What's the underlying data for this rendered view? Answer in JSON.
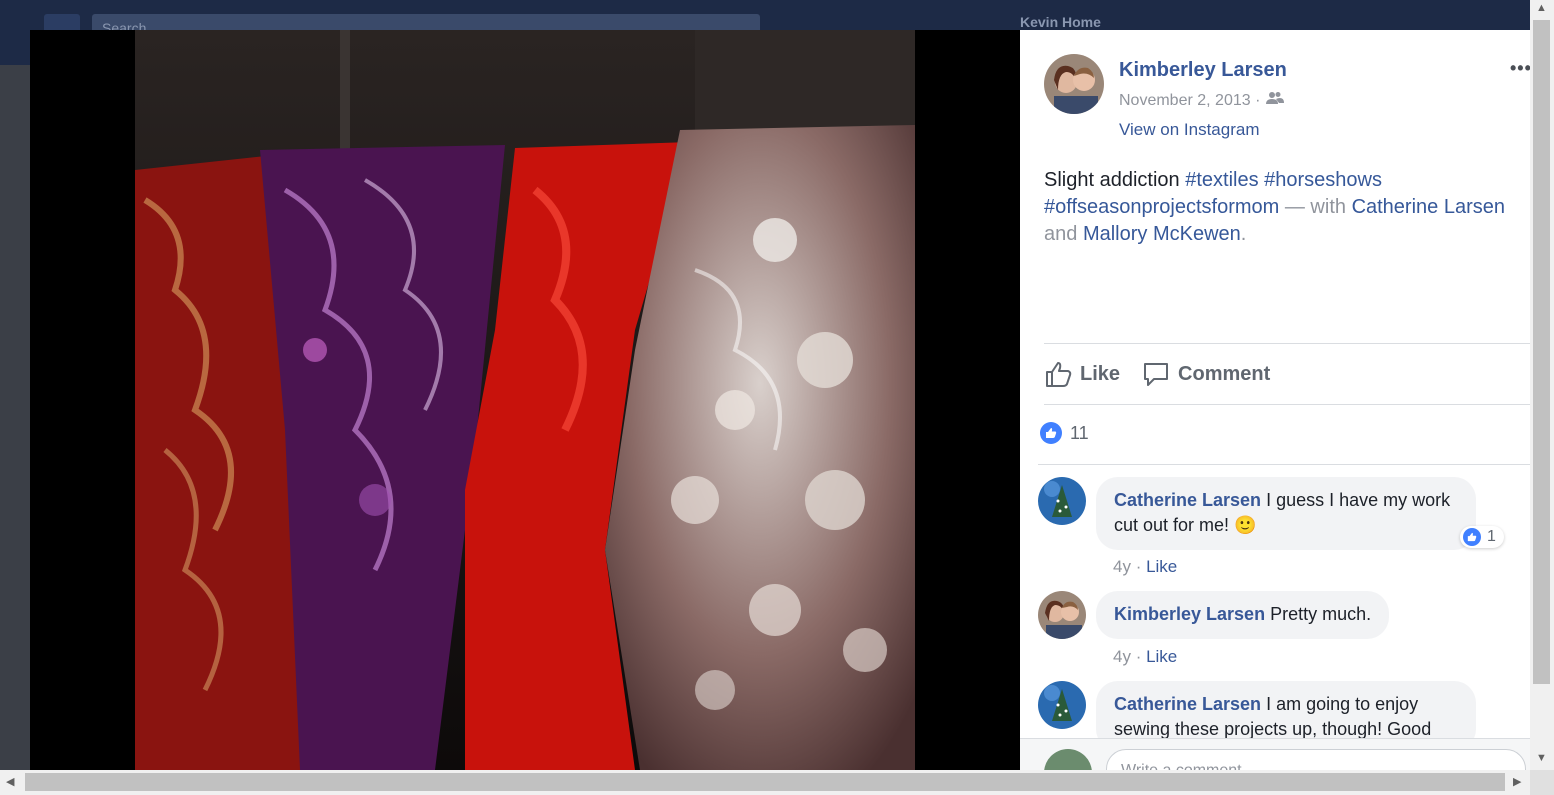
{
  "background": {
    "search_placeholder": "Search",
    "user_label": "Kevin   Home"
  },
  "post": {
    "author": "Kimberley Larsen",
    "date": "November 2, 2013 ·",
    "source_link": "View on Instagram",
    "text_intro": "Slight addiction",
    "hashtags": [
      "#textiles",
      "#horseshows",
      "#offseasonprojectsformom"
    ],
    "with_text": "— with",
    "tagged_people": [
      "Catherine Larsen",
      "Mallory McKewen"
    ],
    "and_text": "and",
    "period": ".",
    "more_label": "•••"
  },
  "actions": {
    "like_label": "Like",
    "comment_label": "Comment"
  },
  "reactions": {
    "like_count": "11"
  },
  "comments": [
    {
      "author": "Catherine Larsen",
      "text_line1": "I guess I have my work",
      "text_line2": "cut out for me!",
      "emoji": "🙂",
      "age": "4y",
      "like_label": "Like",
      "reaction_count": "1"
    },
    {
      "author": "Kimberley Larsen",
      "text_line1": "Pretty much.",
      "age": "4y",
      "like_label": "Like"
    },
    {
      "author": "Catherine Larsen",
      "text_line1": "I am going to enjoy",
      "text_line2": "sewing these projects up, though! Good"
    }
  ],
  "composer": {
    "placeholder": "Write a comment..."
  },
  "colors": {
    "link": "#385898",
    "reaction_blue": "#4080ff",
    "panel_bg": "#ffffff",
    "viewer_bg": "#000000"
  },
  "icons": [
    "audience-friends-icon",
    "like-thumb-icon",
    "comment-bubble-icon",
    "reaction-like-icon",
    "camera-icon",
    "gif-icon",
    "sticker-icon"
  ]
}
